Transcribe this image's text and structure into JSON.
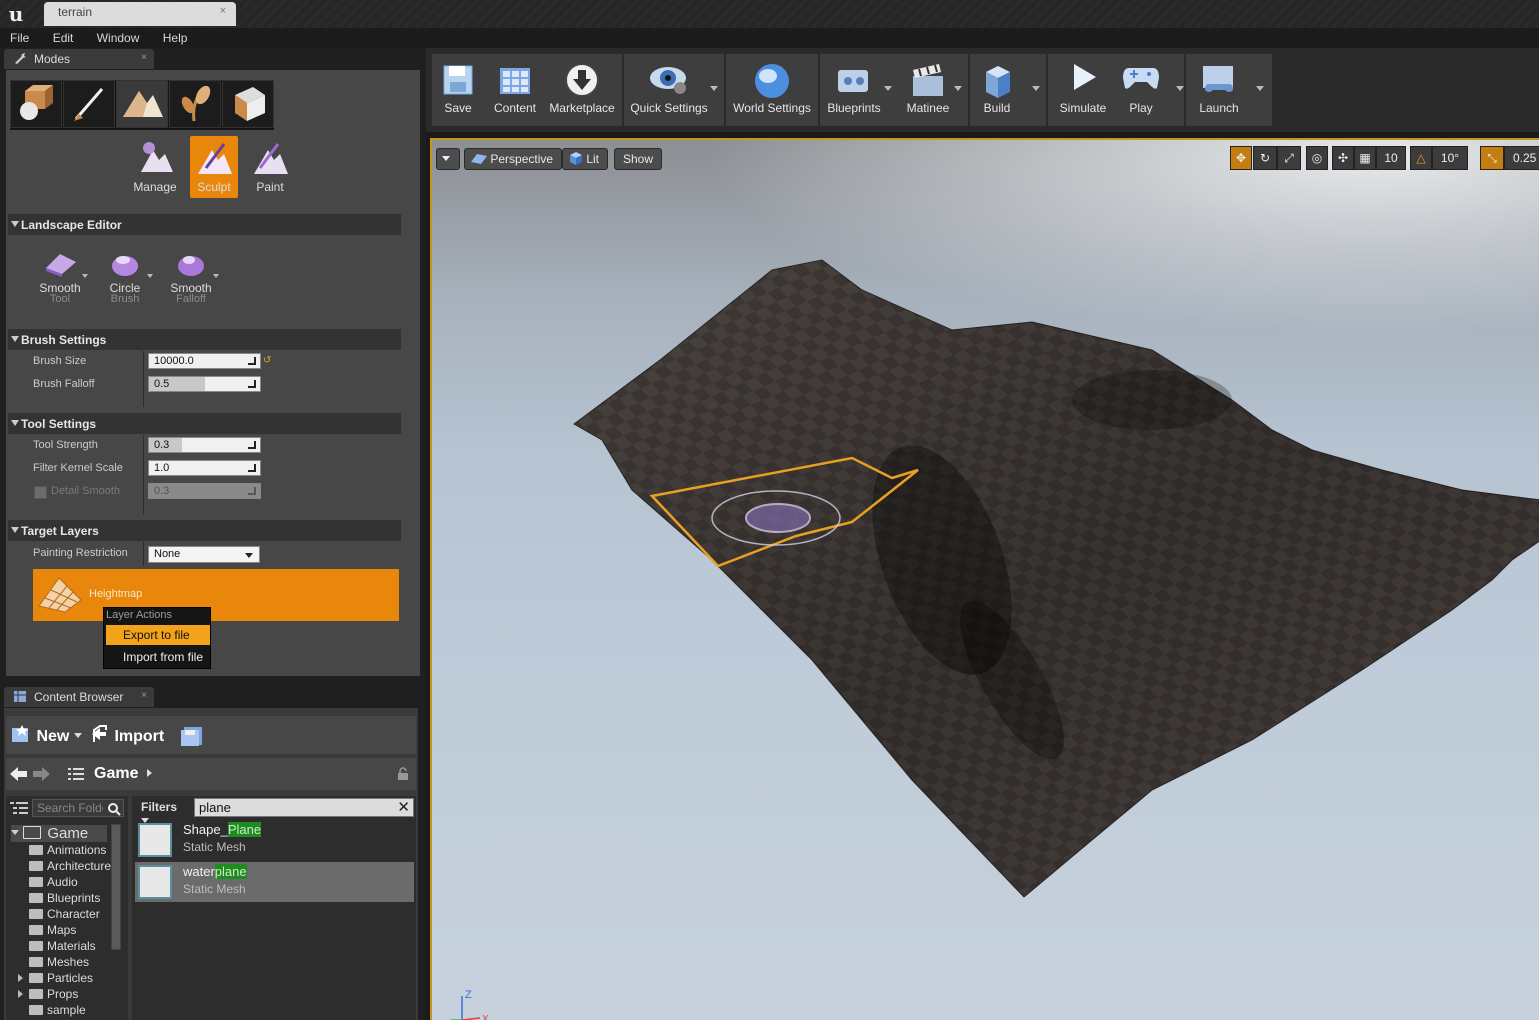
{
  "titlebar": {
    "tab_title": "terrain",
    "close": "×",
    "logo": "u"
  },
  "menu": {
    "items": [
      "File",
      "Edit",
      "Window",
      "Help"
    ]
  },
  "modes_panel": {
    "tab_label": "Modes",
    "close": "×",
    "mode_icons": [
      "place-mode-icon",
      "paint-mode-icon",
      "landscape-mode-icon",
      "foliage-mode-icon",
      "geometry-mode-icon"
    ],
    "sub_modes": [
      {
        "label": "Manage",
        "active": false
      },
      {
        "label": "Sculpt",
        "active": true
      },
      {
        "label": "Paint",
        "active": false
      }
    ],
    "landscape_editor": {
      "title": "Landscape Editor",
      "tools": [
        {
          "label": "Smooth",
          "sub": "Tool"
        },
        {
          "label": "Circle",
          "sub": "Brush"
        },
        {
          "label": "Smooth",
          "sub": "Falloff"
        }
      ]
    },
    "brush_settings": {
      "title": "Brush Settings",
      "brush_size_label": "Brush Size",
      "brush_size_value": "10000.0",
      "brush_falloff_label": "Brush Falloff",
      "brush_falloff_value": "0.5",
      "brush_falloff_fraction": 0.5
    },
    "tool_settings": {
      "title": "Tool Settings",
      "tool_strength_label": "Tool Strength",
      "tool_strength_value": "0.3",
      "tool_strength_fraction": 0.3,
      "filter_kernel_label": "Filter Kernel Scale",
      "filter_kernel_value": "1.0",
      "detail_smooth_label": "Detail Smooth",
      "detail_smooth_value": "0.3"
    },
    "target_layers": {
      "title": "Target Layers",
      "painting_restriction_label": "Painting Restriction",
      "painting_restriction_value": "None",
      "heightmap_label": "Heightmap",
      "context_menu": {
        "header": "Layer Actions",
        "export": "Export to file",
        "import": "Import from file"
      }
    }
  },
  "content_browser": {
    "tab_label": "Content Browser",
    "close": "×",
    "new_label": "New",
    "import_label": "Import",
    "path_root": "Game",
    "search_folders_placeholder": "Search Folders",
    "filters_label": "Filters",
    "filter_text": "plane",
    "clear": "✕",
    "tree_root": "Game",
    "folders": [
      "Animations",
      "Architecture",
      "Audio",
      "Blueprints",
      "Character",
      "Maps",
      "Materials",
      "Meshes",
      "Particles",
      "Props",
      "sample"
    ],
    "assets": [
      {
        "name_prefix": "Shape_",
        "name_match": "Plane",
        "type": "Static Mesh"
      },
      {
        "name_prefix": "water",
        "name_match": "plane",
        "type": "Static Mesh"
      }
    ]
  },
  "toolbar": {
    "save": "Save",
    "content": "Content",
    "marketplace": "Marketplace",
    "quick_settings": "Quick Settings",
    "world_settings": "World Settings",
    "blueprints": "Blueprints",
    "matinee": "Matinee",
    "build": "Build",
    "simulate": "Simulate",
    "play": "Play",
    "launch": "Launch"
  },
  "viewport": {
    "perspective": "Perspective",
    "lit": "Lit",
    "show": "Show",
    "grid_snap": "10",
    "rotation_snap": "10°",
    "scale_snap": "0.25",
    "axis_z": "Z",
    "axis_x": "X"
  },
  "colors": {
    "accent": "#e8870c",
    "highlight": "#f2a31a",
    "filter_match": "#1e8c1e"
  }
}
